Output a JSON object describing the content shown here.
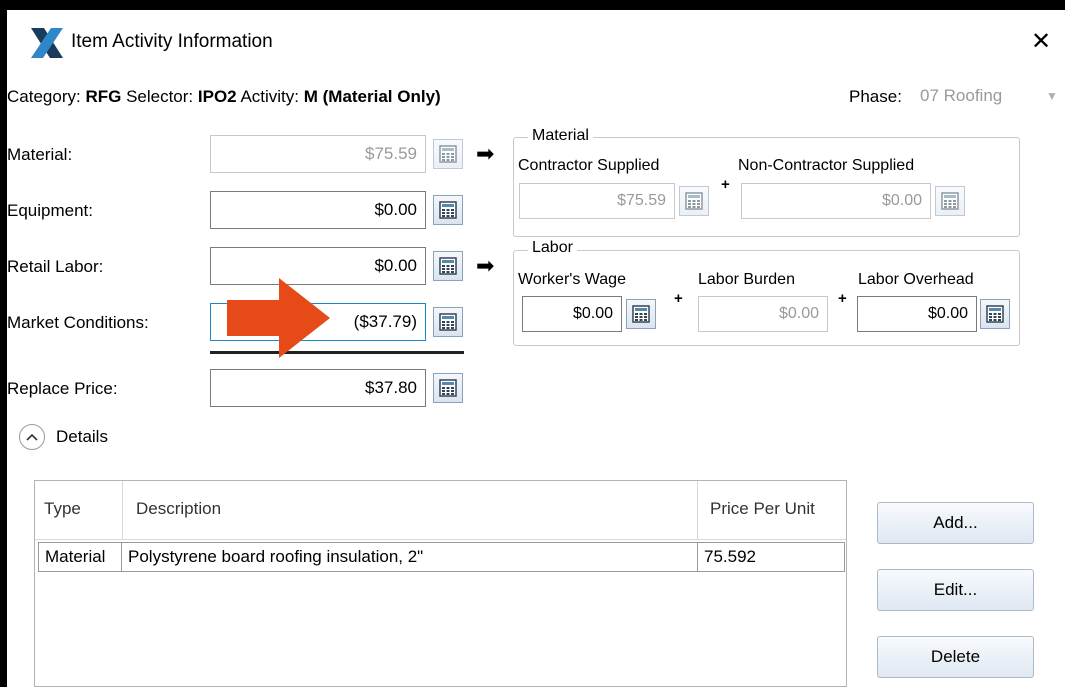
{
  "window": {
    "title": "Item Activity Information"
  },
  "header": {
    "category_label": "Category:",
    "category_value": "RFG",
    "selector_label": "Selector:",
    "selector_value": "IPO2",
    "activity_label": "Activity:",
    "activity_value": "M (Material Only)",
    "phase_label": "Phase:",
    "phase_value": "07 Roofing"
  },
  "fields": {
    "material": {
      "label": "Material:",
      "value": "$75.59"
    },
    "equipment": {
      "label": "Equipment:",
      "value": "$0.00"
    },
    "retail_labor": {
      "label": "Retail Labor:",
      "value": "$0.00"
    },
    "market_conditions": {
      "label": "Market Conditions:",
      "value": "($37.79)"
    },
    "replace_price": {
      "label": "Replace Price:",
      "value": "$37.80"
    }
  },
  "material_group": {
    "legend": "Material",
    "contractor_label": "Contractor Supplied",
    "contractor_value": "$75.59",
    "noncontractor_label": "Non-Contractor Supplied",
    "noncontractor_value": "$0.00"
  },
  "labor_group": {
    "legend": "Labor",
    "wage_label": "Worker's Wage",
    "wage_value": "$0.00",
    "burden_label": "Labor Burden",
    "burden_value": "$0.00",
    "overhead_label": "Labor Overhead",
    "overhead_value": "$0.00"
  },
  "details": {
    "label": "Details"
  },
  "table": {
    "headers": [
      "Type",
      "Description",
      "Price Per Unit"
    ],
    "rows": [
      {
        "type": "Material",
        "description": "Polystyrene board roofing insulation, 2\"",
        "price": "75.592"
      }
    ]
  },
  "buttons": {
    "add": "Add...",
    "edit": "Edit...",
    "delete": "Delete"
  },
  "colors": {
    "annotation_arrow": "#e64a19",
    "accent": "#1e88c7"
  }
}
